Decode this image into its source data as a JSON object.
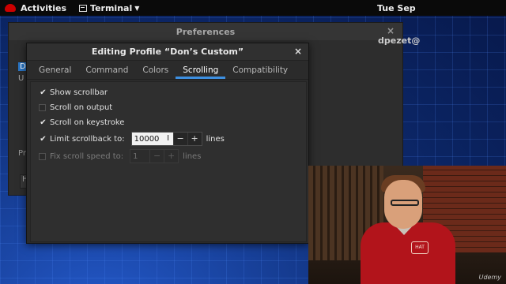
{
  "topbar": {
    "activities": "Activities",
    "app_menu": "Terminal",
    "clock": "Tue Sep"
  },
  "background_window": {
    "title": "Preferences",
    "side_labels": [
      "D",
      "U"
    ],
    "bottom_label": "Pr",
    "bottom_button": "H",
    "user_label": "dpezet@"
  },
  "dialog": {
    "title": "Editing Profile “Don’s Custom”",
    "tabs": [
      "General",
      "Command",
      "Colors",
      "Scrolling",
      "Compatibility"
    ],
    "active_tab": "Scrolling",
    "options": {
      "show_scrollbar": {
        "label": "Show scrollbar",
        "checked": true
      },
      "scroll_on_output": {
        "label": "Scroll on output",
        "checked": false
      },
      "scroll_on_keystroke": {
        "label": "Scroll on keystroke",
        "checked": true
      },
      "limit_scrollback": {
        "label": "Limit scrollback to:",
        "checked": true,
        "value": "10000",
        "unit": "lines"
      },
      "fix_scroll_speed": {
        "label": "Fix scroll speed to:",
        "checked": false,
        "value": "1",
        "unit": "lines"
      }
    }
  },
  "webcam": {
    "badge_text": "HAT",
    "watermark": "Udemy"
  },
  "colors": {
    "accent": "#3d8fe0",
    "shirt": "#b2141b"
  }
}
